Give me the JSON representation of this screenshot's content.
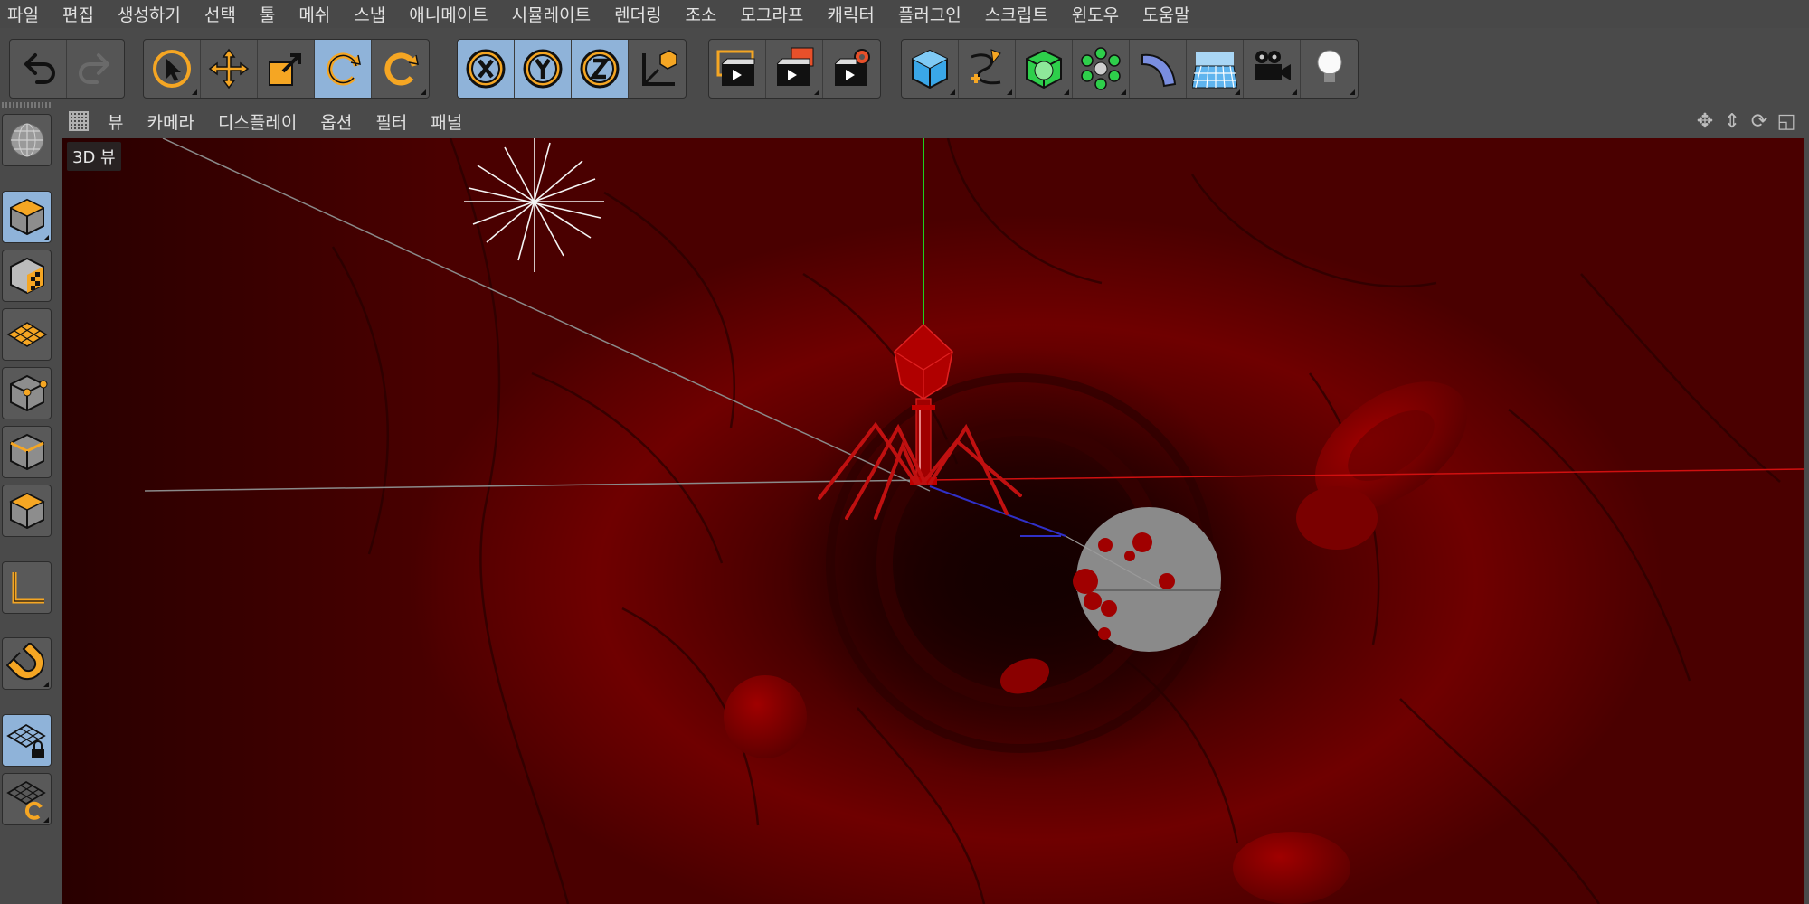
{
  "menu": [
    "파일",
    "편집",
    "생성하기",
    "선택",
    "툴",
    "메쉬",
    "스냅",
    "애니메이트",
    "시뮬레이트",
    "렌더링",
    "조소",
    "모그라프",
    "캐릭터",
    "플러그인",
    "스크립트",
    "윈도우",
    "도움말"
  ],
  "viewmenu": [
    "뷰",
    "카메라",
    "디스플레이",
    "옵션",
    "필터",
    "패널"
  ],
  "viewport": {
    "label": "3D 뷰"
  },
  "colors": {
    "accent_orange": "#f5a623",
    "active_blue": "#8fb3d9",
    "axis_x": "#d01010",
    "axis_y": "#1fcf1f",
    "axis_z": "#3030c8"
  },
  "toolbar_icons": [
    "undo-icon",
    "redo-icon",
    "live-selection-icon",
    "move-icon",
    "scale-icon",
    "rotate-icon",
    "recent-tool-icon",
    "x-axis-lock-icon",
    "y-axis-lock-icon",
    "z-axis-lock-icon",
    "coordinate-system-icon",
    "render-view-icon",
    "render-to-picture-viewer-icon",
    "render-settings-icon",
    "cube-primitive-icon",
    "spline-pen-icon",
    "subdivision-surface-icon",
    "cloner-icon",
    "deformer-icon",
    "floor-icon",
    "camera-icon",
    "light-icon"
  ],
  "palette_icons": [
    "make-editable-icon",
    "model-mode-icon",
    "texture-mode-icon",
    "workplane-mode-icon",
    "points-mode-icon",
    "edges-mode-icon",
    "polygons-mode-icon",
    "axis-mode-icon",
    "snap-magnet-icon",
    "workplane-lock-icon",
    "workplane-align-icon"
  ]
}
